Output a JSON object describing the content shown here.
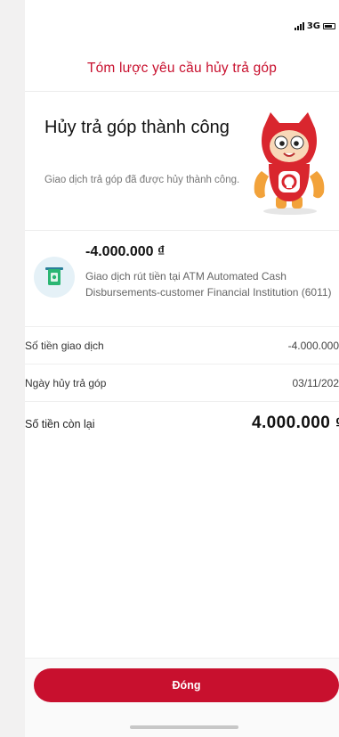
{
  "status_bar": {
    "network": "3G"
  },
  "header": {
    "title": "Tóm lược yêu cầu hủy trả góp"
  },
  "result": {
    "title": "Hủy trả góp thành công",
    "description": "Giao dịch trả góp đã được hủy thành công.",
    "mascot_icon": "mascot-icon"
  },
  "transaction": {
    "icon": "atm-cash-icon",
    "amount": "-4.000.000 ₫",
    "description": "Giao dịch rút tiền tại ATM Automated Cash Disbursements-customer Financial Institution (6011)"
  },
  "details": [
    {
      "label": "Số tiền giao dịch",
      "value": "-4.000.000"
    },
    {
      "label": "Ngày hủy trả góp",
      "value": "03/11/202"
    }
  ],
  "remaining": {
    "label": "Số tiền còn lại",
    "value": "4.000.000 ₫"
  },
  "footer": {
    "close_label": "Đóng"
  },
  "colors": {
    "accent": "#c8102e",
    "icon_bg": "#e5f1f7",
    "icon_green": "#2bb673"
  }
}
